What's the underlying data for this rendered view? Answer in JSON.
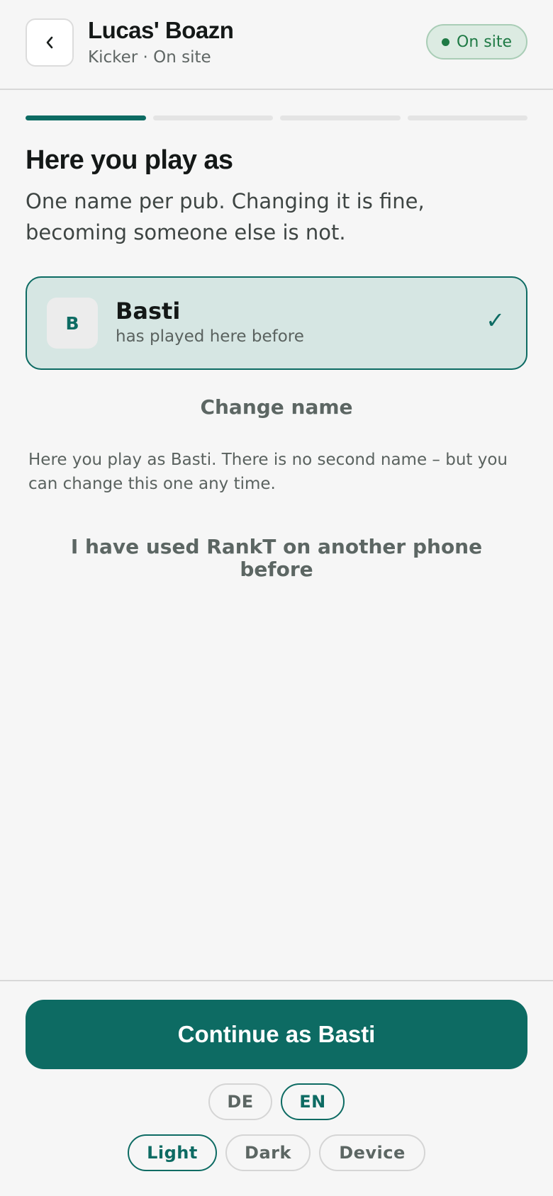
{
  "header": {
    "title": "Lucas' Boazn",
    "subtitle": "Kicker · On site",
    "status": "On site",
    "back_icon": "chevron-left-icon"
  },
  "progress": {
    "current_step": 1,
    "total_steps": 4
  },
  "main": {
    "title": "Here you play as",
    "subtitle": "One name per pub. Changing it is fine, becoming someone else is not.",
    "identity": {
      "avatar_initial": "B",
      "name": "Basti",
      "note": "has played here before",
      "check": "✓",
      "selected": true
    },
    "change_name_label": "Change name",
    "info_text": "Here you play as Basti. There is no second name – but you can change this one any time.",
    "other_phone_label": "I have used RankT on another phone before"
  },
  "footer": {
    "continue_label": "Continue as Basti",
    "languages": [
      {
        "label": "DE",
        "active": false
      },
      {
        "label": "EN",
        "active": true
      }
    ],
    "themes": [
      {
        "label": "Light",
        "active": true
      },
      {
        "label": "Dark",
        "active": false
      },
      {
        "label": "Device",
        "active": false
      }
    ]
  },
  "colors": {
    "accent": "#0d6b63",
    "status_green": "#1f7a45",
    "background": "#f6f6f6",
    "selected_card": "#d6e6e3"
  }
}
